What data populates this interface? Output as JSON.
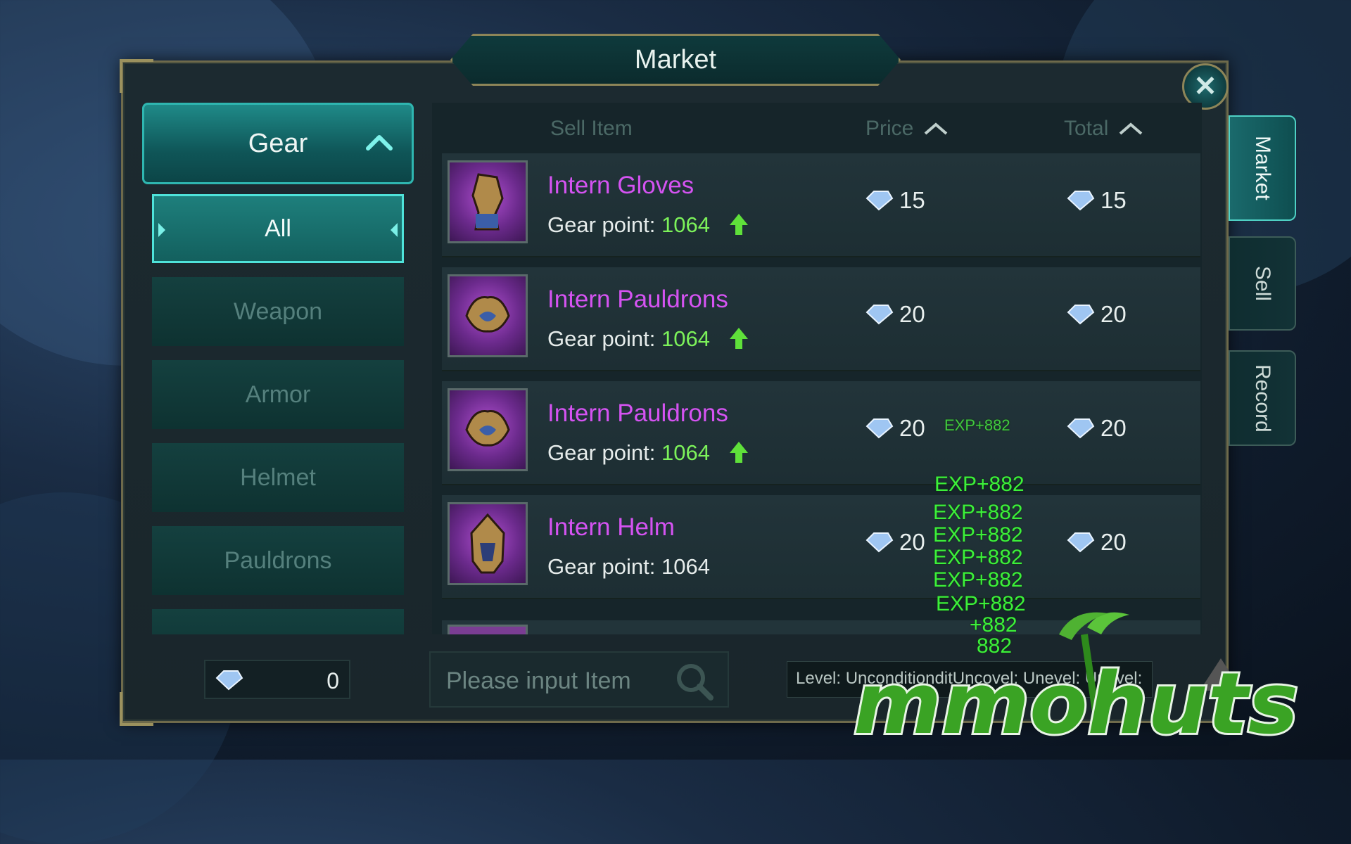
{
  "window": {
    "title": "Market",
    "close_icon": "close-icon"
  },
  "side_tabs": [
    {
      "label": "Market",
      "active": true
    },
    {
      "label": "Sell",
      "active": false
    },
    {
      "label": "Record",
      "active": false
    }
  ],
  "category": {
    "header": "Gear",
    "items": [
      {
        "label": "All",
        "active": true
      },
      {
        "label": "Weapon",
        "active": false
      },
      {
        "label": "Armor",
        "active": false
      },
      {
        "label": "Helmet",
        "active": false
      },
      {
        "label": "Pauldrons",
        "active": false
      }
    ]
  },
  "columns": {
    "sell_item": "Sell Item",
    "price": "Price",
    "total": "Total"
  },
  "items": [
    {
      "name": "Intern Gloves",
      "gear_label": "Gear point:",
      "gear_point": "1064",
      "upgrade": true,
      "price": "15",
      "total": "15"
    },
    {
      "name": "Intern Pauldrons",
      "gear_label": "Gear point:",
      "gear_point": "1064",
      "upgrade": true,
      "price": "20",
      "total": "20"
    },
    {
      "name": "Intern Pauldrons",
      "gear_label": "Gear point:",
      "gear_point": "1064",
      "upgrade": true,
      "price": "20",
      "total": "20"
    },
    {
      "name": "Intern Helm",
      "gear_label": "Gear point:",
      "gear_point": "1064",
      "upgrade": false,
      "price": "20",
      "total": "20"
    }
  ],
  "currency": {
    "value": "0"
  },
  "search": {
    "placeholder": "Please input Item"
  },
  "level_filter": "Level: UnconditionditUncovel: Unevel: Unevel:",
  "exp_popups": [
    "EXP+882",
    "EXP+882",
    "EXP+882",
    "EXP+882",
    "EXP+882",
    "EXP+882",
    "EXP+882",
    "+882",
    "882"
  ],
  "colors": {
    "accent": "#2fb6b0",
    "item_name": "#d553f2",
    "gear_up": "#7cf25a",
    "exp": "#3cf03a"
  },
  "watermark": "mmohuts"
}
